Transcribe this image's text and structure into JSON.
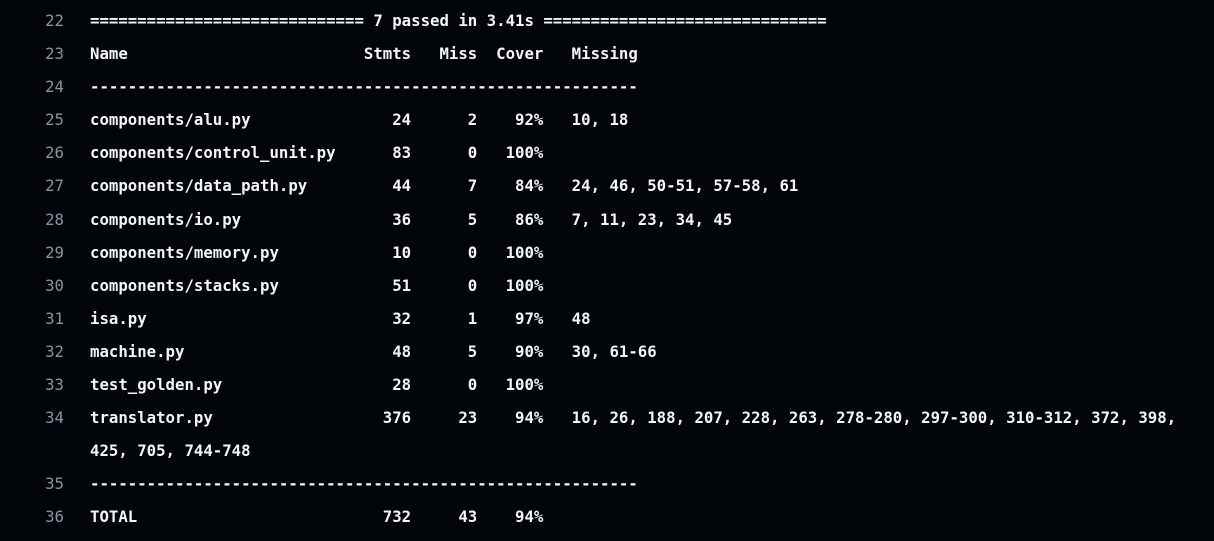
{
  "log": {
    "lines": [
      {
        "num": "22",
        "text": "============================= 7 passed in 3.41s =============================="
      },
      {
        "num": "23",
        "text": "Name                         Stmts   Miss  Cover   Missing"
      },
      {
        "num": "24",
        "text": "----------------------------------------------------------"
      },
      {
        "num": "25",
        "text": "components/alu.py               24      2    92%   10, 18"
      },
      {
        "num": "26",
        "text": "components/control_unit.py      83      0   100%"
      },
      {
        "num": "27",
        "text": "components/data_path.py         44      7    84%   24, 46, 50-51, 57-58, 61"
      },
      {
        "num": "28",
        "text": "components/io.py                36      5    86%   7, 11, 23, 34, 45"
      },
      {
        "num": "29",
        "text": "components/memory.py            10      0   100%"
      },
      {
        "num": "30",
        "text": "components/stacks.py            51      0   100%"
      },
      {
        "num": "31",
        "text": "isa.py                          32      1    97%   48"
      },
      {
        "num": "32",
        "text": "machine.py                      48      5    90%   30, 61-66"
      },
      {
        "num": "33",
        "text": "test_golden.py                  28      0   100%"
      },
      {
        "num": "34",
        "text": "translator.py                  376     23    94%   16, 26, 188, 207, 228, 263, 278-280, 297-300, 310-312, 372, 398, 425, 705, 744-748"
      },
      {
        "num": "35",
        "text": "----------------------------------------------------------"
      },
      {
        "num": "36",
        "text": "TOTAL                          732     43    94%"
      }
    ]
  }
}
